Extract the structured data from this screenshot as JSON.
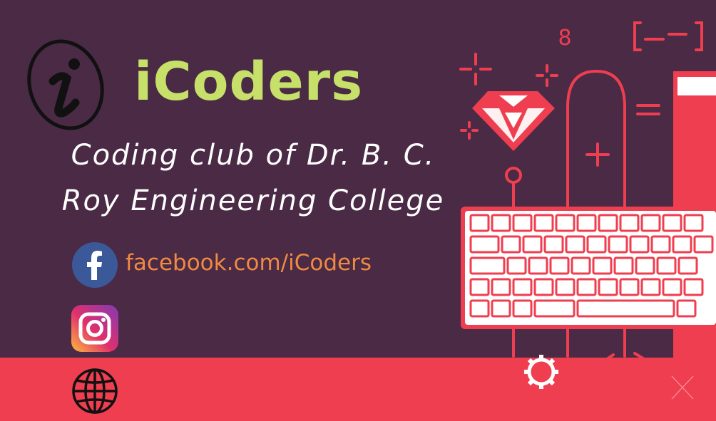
{
  "brand": {
    "name": "iCoders",
    "tagline_line1": "Coding club of Dr. B. C.",
    "tagline_line2": "Roy Engineering College"
  },
  "social": {
    "facebook": {
      "icon": "facebook-icon",
      "text": "facebook.com/iCoders"
    },
    "instagram": {
      "icon": "instagram-icon"
    },
    "website": {
      "icon": "globe-icon"
    }
  },
  "decor": {
    "number": "8"
  },
  "colors": {
    "background": "#4a2a45",
    "band": "#ef3e4f",
    "brand_green": "#c6e06a",
    "link_orange": "#f08a42",
    "accent_red": "#ef3e4f"
  }
}
